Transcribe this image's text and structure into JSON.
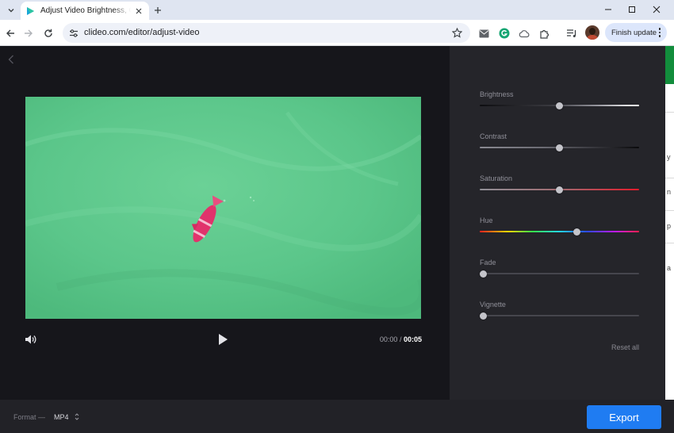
{
  "browser": {
    "tab": {
      "title": "Adjust Video Brightness, Contrast"
    },
    "address": {
      "url": "clideo.com/editor/adjust-video"
    },
    "update_button": {
      "label": "Finish update"
    }
  },
  "player": {
    "current_time": "00:00",
    "separator": "/",
    "duration": "00:05"
  },
  "adjustments": {
    "items": [
      {
        "label": "Brightness",
        "value": 0.5
      },
      {
        "label": "Contrast",
        "value": 0.5
      },
      {
        "label": "Saturation",
        "value": 0.5
      },
      {
        "label": "Hue",
        "value": 0.61
      },
      {
        "label": "Fade",
        "value": 0.0
      },
      {
        "label": "Vignette",
        "value": 0.0
      }
    ],
    "reset_label": "Reset all"
  },
  "footer": {
    "format_label": "Format —",
    "format_value": "MP4",
    "export_label": "Export"
  },
  "side_edge": {
    "chars": [
      "y",
      "n",
      "p",
      "a"
    ]
  },
  "colors": {
    "accent": "#1f7cf2",
    "editor_bg": "#16161b",
    "panel_bg": "#25252a",
    "video_water": "#57c383",
    "fish": "#e1336c"
  }
}
